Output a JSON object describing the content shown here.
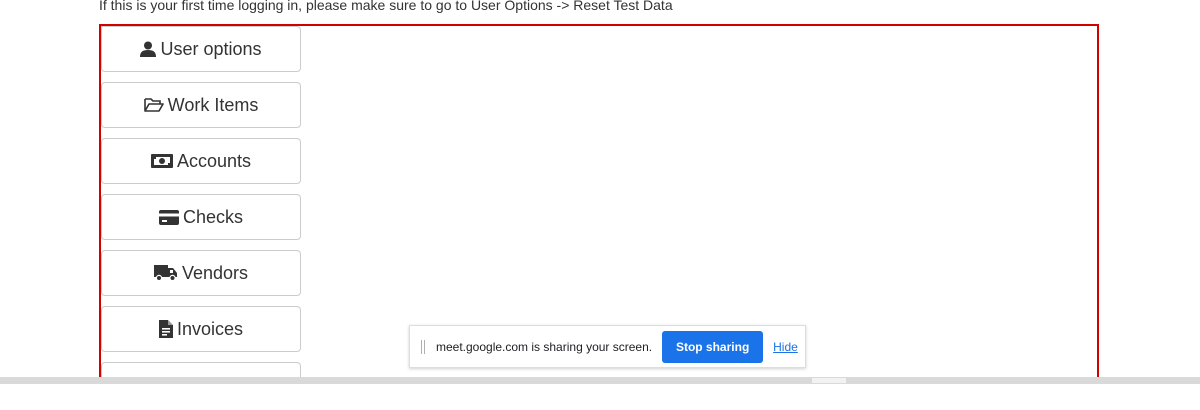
{
  "notice": "If this is your first time logging in, please make sure to go to User Options -> Reset Test Data",
  "menu": [
    {
      "label": "User options",
      "icon": "user-icon"
    },
    {
      "label": "Work Items",
      "icon": "folder-open-icon"
    },
    {
      "label": "Accounts",
      "icon": "money-bill-icon"
    },
    {
      "label": "Checks",
      "icon": "credit-card-icon"
    },
    {
      "label": "Vendors",
      "icon": "truck-icon"
    },
    {
      "label": "Invoices",
      "icon": "file-invoice-icon"
    }
  ],
  "share_bar": {
    "message": "meet.google.com is sharing your screen.",
    "stop_label": "Stop sharing",
    "hide_label": "Hide"
  },
  "colors": {
    "frame_border": "#d40000",
    "stop_button": "#1a73e8"
  }
}
